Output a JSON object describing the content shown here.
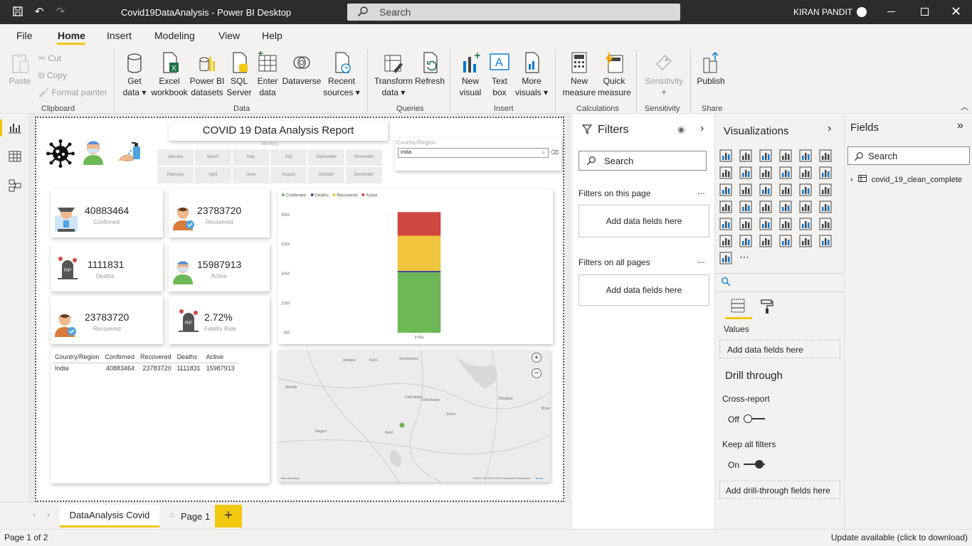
{
  "window": {
    "title": "Covid19DataAnalysis - Power BI Desktop",
    "search_placeholder": "Search",
    "user": "KIRAN PANDIT"
  },
  "menu": {
    "items": [
      "File",
      "Home",
      "Insert",
      "Modeling",
      "View",
      "Help"
    ],
    "active": "Home"
  },
  "ribbon": {
    "clipboard": {
      "paste": "Paste",
      "cut": "Cut",
      "copy": "Copy",
      "format_painter": "Format painter",
      "group": "Clipboard"
    },
    "data": {
      "get_data": [
        "Get",
        "data"
      ],
      "excel": [
        "Excel",
        "workbook"
      ],
      "pbi": [
        "Power BI",
        "datasets"
      ],
      "sql": [
        "SQL",
        "Server"
      ],
      "enter": [
        "Enter",
        "data"
      ],
      "dataverse": "Dataverse",
      "recent": [
        "Recent",
        "sources"
      ],
      "group": "Data"
    },
    "queries": {
      "transform": [
        "Transform",
        "data"
      ],
      "refresh": "Refresh",
      "group": "Queries"
    },
    "insert": {
      "new_visual": [
        "New",
        "visual"
      ],
      "text_box": [
        "Text",
        "box"
      ],
      "more_visuals": [
        "More",
        "visuals"
      ],
      "group": "Insert"
    },
    "calculations": {
      "new_measure": [
        "New",
        "measure"
      ],
      "quick_measure": [
        "Quick",
        "measure"
      ],
      "group": "Calculations"
    },
    "sensitivity": {
      "label": "Sensitivity",
      "group": "Sensitivity"
    },
    "share": {
      "publish": "Publish",
      "group": "Share"
    }
  },
  "report": {
    "title": "COVID 19 Data Analysis Report",
    "month_slicer": {
      "header": "Month(s)",
      "months": [
        "January",
        "March",
        "May",
        "July",
        "September",
        "November",
        "February",
        "April",
        "June",
        "August",
        "October",
        "December"
      ]
    },
    "country_slicer": {
      "header": "Country/Region",
      "value": "India"
    },
    "kpis": [
      {
        "value": "40883464",
        "label": "Confirmed"
      },
      {
        "value": "23783720",
        "label": "Recovered"
      },
      {
        "value": "1111831",
        "label": "Deaths"
      },
      {
        "value": "15987913",
        "label": "Active"
      },
      {
        "value": "23783720",
        "label": "Recovered"
      },
      {
        "value": "2.72%",
        "label": "Fatality Rate"
      }
    ],
    "table": {
      "headers": [
        "Country/Region",
        "Confirmed",
        "Recovered",
        "Deaths",
        "Active"
      ],
      "rows": [
        [
          "India",
          "40883464",
          "23783720",
          "1111831",
          "15987913"
        ]
      ]
    },
    "map": {
      "places": [
        "Jabalpur",
        "Katni",
        "Narsinghpur",
        "Mandla",
        "Lakhnadon",
        "Chhindwara",
        "Seoni",
        "Balaghat",
        "Betul",
        "Nagpur",
        "Bhandara"
      ],
      "attribution": "©2022 TomTom ©2022 Microsoft Corporation",
      "terms": "Terms",
      "provider": "Microsoft Bing",
      "zoom_in": "+",
      "zoom_out": "−"
    }
  },
  "chart_data": {
    "type": "bar",
    "stacked": true,
    "categories": [
      "India"
    ],
    "series": [
      {
        "name": "Confirmed",
        "color": "#6db856",
        "values": [
          40883464
        ]
      },
      {
        "name": "Deaths",
        "color": "#3f4d8c",
        "values": [
          1111831
        ]
      },
      {
        "name": "Recovered",
        "color": "#f0c43c",
        "values": [
          23783720
        ]
      },
      {
        "name": "Active",
        "color": "#d0473e",
        "values": [
          15987913
        ]
      }
    ],
    "ylim": [
      0,
      80000000
    ],
    "yticks": [
      "0M",
      "20M",
      "40M",
      "60M",
      "80M"
    ],
    "legend": "top-left",
    "xlabel": "",
    "ylabel": ""
  },
  "filters": {
    "title": "Filters",
    "search": "Search",
    "on_page": "Filters on this page",
    "on_all": "Filters on all pages",
    "add_fields": "Add data fields here",
    "more": "..."
  },
  "visualizations": {
    "title": "Visualizations",
    "values_label": "Values",
    "add_fields": "Add data fields here",
    "drill_through": "Drill through",
    "cross_report": "Cross-report",
    "off": "Off",
    "keep_all": "Keep all filters",
    "on": "On",
    "add_drill": "Add drill-through fields here"
  },
  "fields": {
    "title": "Fields",
    "search": "Search",
    "table": "covid_19_clean_complete"
  },
  "tabs": {
    "items": [
      "DataAnalysis Covid",
      "Page 1"
    ],
    "add": "+"
  },
  "status": {
    "page": "Page 1 of 2",
    "update": "Update available (click to download)"
  }
}
